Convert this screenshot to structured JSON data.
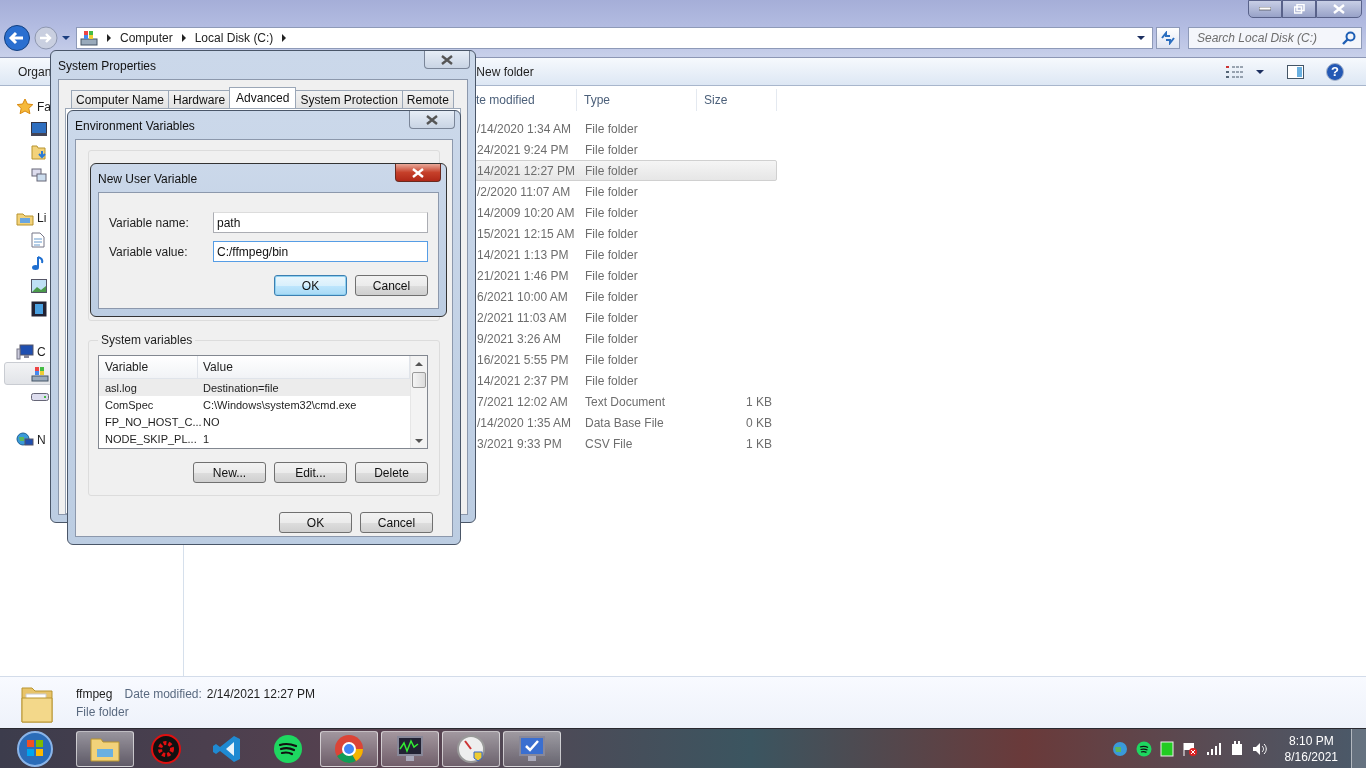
{
  "explorer": {
    "breadcrumb": [
      "Computer",
      "Local Disk (C:)"
    ],
    "search": {
      "placeholder": "Search Local Disk (C:)"
    },
    "toolbar": {
      "organize": "Organ",
      "new_folder": "New folder",
      "help": "?"
    },
    "nav": [
      {
        "label": "Fa",
        "kind": "star",
        "items": [
          {
            "kind": "desktop",
            "selected": false
          },
          {
            "kind": "downloads",
            "selected": false
          },
          {
            "kind": "recent",
            "selected": false
          }
        ]
      },
      {
        "label": "Li",
        "kind": "library",
        "items": [
          {
            "kind": "documents",
            "selected": false
          },
          {
            "kind": "music",
            "selected": false
          },
          {
            "kind": "pictures",
            "selected": false
          },
          {
            "kind": "videos",
            "selected": false
          }
        ]
      },
      {
        "label": "C",
        "kind": "computer",
        "items": [
          {
            "kind": "system-drive",
            "selected": true
          },
          {
            "kind": "drive",
            "selected": false
          }
        ]
      },
      {
        "label": "N",
        "kind": "network"
      }
    ],
    "columns": [
      "te modified",
      "Type",
      "Size"
    ],
    "rows": [
      {
        "date": "/14/2020 1:34 AM",
        "type": "File folder",
        "selected": false
      },
      {
        "date": "24/2021 9:24 PM",
        "type": "File folder",
        "selected": false
      },
      {
        "date": "14/2021 12:27 PM",
        "type": "File folder",
        "selected": true
      },
      {
        "date": "/2/2020 11:07 AM",
        "type": "File folder",
        "selected": false
      },
      {
        "date": "14/2009 10:20 AM",
        "type": "File folder",
        "selected": false
      },
      {
        "date": "15/2021 12:15 AM",
        "type": "File folder",
        "selected": false
      },
      {
        "date": "14/2021 1:13 PM",
        "type": "File folder",
        "selected": false
      },
      {
        "date": "21/2021 1:46 PM",
        "type": "File folder",
        "selected": false
      },
      {
        "date": "6/2021 10:00 AM",
        "type": "File folder",
        "selected": false
      },
      {
        "date": "2/2021 11:03 AM",
        "type": "File folder",
        "selected": false
      },
      {
        "date": "9/2021 3:26 AM",
        "type": "File folder",
        "selected": false
      },
      {
        "date": "16/2021 5:55 PM",
        "type": "File folder",
        "selected": false
      },
      {
        "date": "14/2021 2:37 PM",
        "type": "File folder",
        "selected": false
      },
      {
        "date": "7/2021 12:02 AM",
        "type": "Text Document",
        "size": "1 KB",
        "selected": false
      },
      {
        "date": "/14/2020 1:35 AM",
        "type": "Data Base File",
        "size": "0 KB",
        "selected": false
      },
      {
        "date": "3/2021 9:33 PM",
        "type": "CSV File",
        "size": "1 KB",
        "selected": false
      }
    ],
    "details": {
      "name": "ffmpeg",
      "date_label": "Date modified:",
      "date": "2/14/2021 12:27 PM",
      "type": "File folder"
    }
  },
  "system_properties": {
    "title": "System Properties",
    "tabs": [
      {
        "label": "Computer Name",
        "selected": false
      },
      {
        "label": "Hardware",
        "selected": false
      },
      {
        "label": "Advanced",
        "selected": true
      },
      {
        "label": "System Protection",
        "selected": false
      },
      {
        "label": "Remote",
        "selected": false
      }
    ]
  },
  "environment_variables": {
    "title": "Environment Variables",
    "system_variables": {
      "label": "System variables",
      "columns": [
        "Variable",
        "Value"
      ],
      "rows": [
        {
          "variable": "asl.log",
          "value": "Destination=file",
          "selected": true
        },
        {
          "variable": "ComSpec",
          "value": "C:\\Windows\\system32\\cmd.exe",
          "selected": false
        },
        {
          "variable": "FP_NO_HOST_C...",
          "value": "NO",
          "selected": false
        },
        {
          "variable": "NODE_SKIP_PL...",
          "value": "1",
          "selected": false
        }
      ],
      "buttons": [
        "New...",
        "Edit...",
        "Delete"
      ]
    },
    "buttons": [
      "OK",
      "Cancel"
    ]
  },
  "new_user_variable": {
    "title": "New User Variable",
    "fields": [
      {
        "label": "Variable name:",
        "value": "path"
      },
      {
        "label": "Variable value:",
        "value": "C:/ffmpeg/bin"
      }
    ],
    "buttons": [
      {
        "label": "OK",
        "default": true
      },
      {
        "label": "Cancel",
        "default": false
      }
    ]
  },
  "taskbar": {
    "apps": [
      {
        "kind": "explorer",
        "running": true
      },
      {
        "kind": "red-gear",
        "running": false
      },
      {
        "kind": "code",
        "running": false
      },
      {
        "kind": "spotify",
        "running": false
      },
      {
        "kind": "chrome",
        "running": true
      },
      {
        "kind": "monitor",
        "running": true
      },
      {
        "kind": "gauge",
        "running": true
      },
      {
        "kind": "check",
        "running": true
      }
    ],
    "clock": {
      "time": "8:10 PM",
      "date": "8/16/2021"
    }
  }
}
